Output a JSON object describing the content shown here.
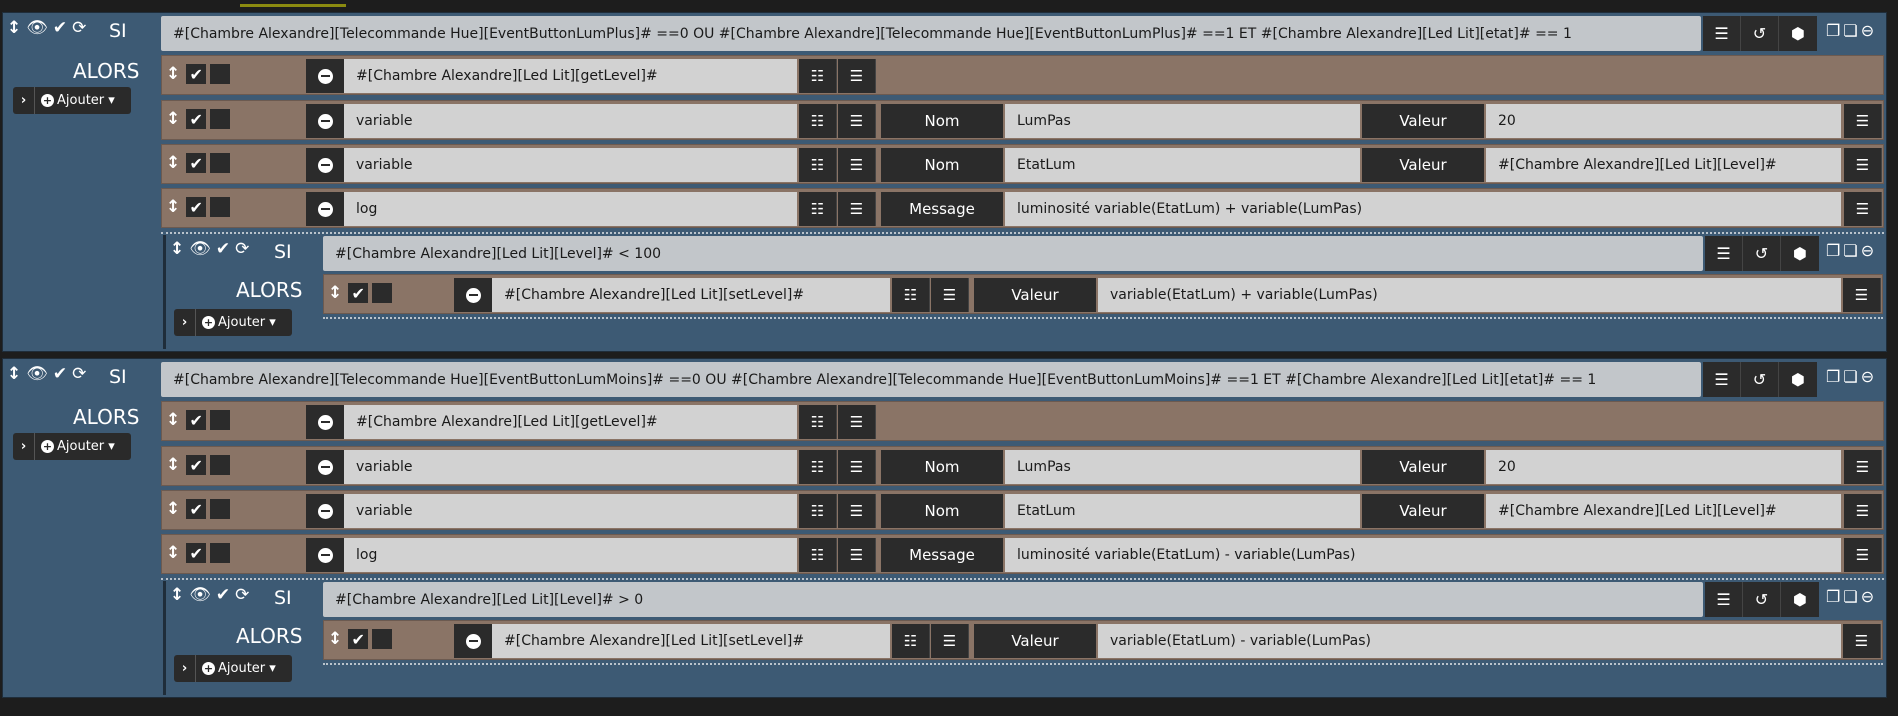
{
  "labels": {
    "si": "SI",
    "alors": "ALORS",
    "ajouter": "Ajouter",
    "nom": "Nom",
    "valeur": "Valeur",
    "message": "Message"
  },
  "colors": {
    "block_bg": "#3d5a74",
    "action_row_bg": "#8a7466",
    "field_bg": "#d2d2d2",
    "button_bg": "#2b2b2b"
  },
  "blocks": [
    {
      "condition": "#[Chambre Alexandre][Telecommande Hue][EventButtonLumPlus]# ==0 OU #[Chambre Alexandre][Telecommande Hue][EventButtonLumPlus]# ==1 ET #[Chambre Alexandre][Led Lit][etat]# == 1",
      "actions": [
        {
          "cmd": "#[Chambre Alexandre][Led Lit][getLevel]#"
        },
        {
          "cmd": "variable",
          "name": "LumPas",
          "value": "20"
        },
        {
          "cmd": "variable",
          "name": "EtatLum",
          "value": "#[Chambre Alexandre][Led Lit][Level]#"
        },
        {
          "cmd": "log",
          "message": "luminosité variable(EtatLum) + variable(LumPas)"
        }
      ],
      "sub": {
        "condition": "#[Chambre Alexandre][Led Lit][Level]# < 100",
        "action": {
          "cmd": "#[Chambre Alexandre][Led Lit][setLevel]#",
          "value": "variable(EtatLum) + variable(LumPas)"
        }
      }
    },
    {
      "condition": "#[Chambre Alexandre][Telecommande Hue][EventButtonLumMoins]# ==0 OU #[Chambre Alexandre][Telecommande Hue][EventButtonLumMoins]# ==1 ET #[Chambre Alexandre][Led Lit][etat]# == 1",
      "actions": [
        {
          "cmd": "#[Chambre Alexandre][Led Lit][getLevel]#"
        },
        {
          "cmd": "variable",
          "name": "LumPas",
          "value": "20"
        },
        {
          "cmd": "variable",
          "name": "EtatLum",
          "value": "#[Chambre Alexandre][Led Lit][Level]#"
        },
        {
          "cmd": "log",
          "message": "luminosité variable(EtatLum) - variable(LumPas)"
        }
      ],
      "sub": {
        "condition": "#[Chambre Alexandre][Led Lit][Level]# > 0",
        "action": {
          "cmd": "#[Chambre Alexandre][Led Lit][setLevel]#",
          "value": "variable(EtatLum) - variable(LumPas)"
        }
      }
    }
  ]
}
